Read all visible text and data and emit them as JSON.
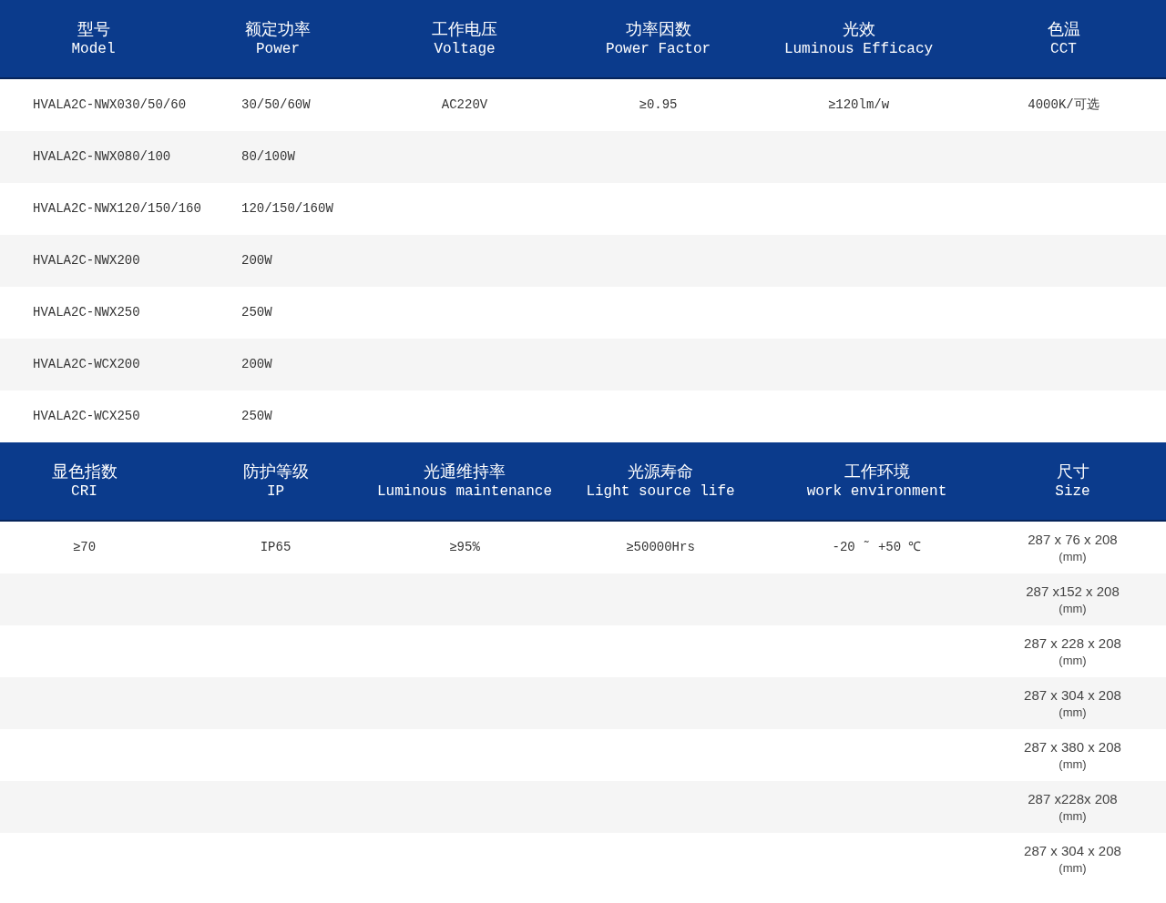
{
  "tables": [
    {
      "columns": [
        {
          "zh": "型号",
          "en": "Model"
        },
        {
          "zh": "额定功率",
          "en": "Power"
        },
        {
          "zh": "工作电压",
          "en": "Voltage"
        },
        {
          "zh": "功率因数",
          "en": "Power Factor"
        },
        {
          "zh": "光效",
          "en": "Luminous Efficacy"
        },
        {
          "zh": "色温",
          "en": "CCT"
        }
      ],
      "rows": [
        [
          "HVALA2C-NWX030/50/60",
          "30/50/60W",
          "AC220V",
          "≥0.95",
          "≥120lm/w",
          "4000K/可选"
        ],
        [
          "HVALA2C-NWX080/100",
          "80/100W",
          null,
          null,
          null,
          null
        ],
        [
          "HVALA2C-NWX120/150/160",
          "120/150/160W",
          null,
          null,
          null,
          null
        ],
        [
          "HVALA2C-NWX200",
          "200W",
          null,
          null,
          null,
          null
        ],
        [
          "HVALA2C-NWX250",
          "250W",
          null,
          null,
          null,
          null
        ],
        [
          "HVALA2C-WCX200",
          "200W",
          null,
          null,
          null,
          null
        ],
        [
          "HVALA2C-WCX250",
          "250W",
          null,
          null,
          null,
          null
        ]
      ]
    },
    {
      "columns": [
        {
          "zh": "显色指数",
          "en": "CRI"
        },
        {
          "zh": "防护等级",
          "en": "IP"
        },
        {
          "zh": "光通维持率",
          "en": "Luminous maintenance"
        },
        {
          "zh": "光源寿命",
          "en": "Light source life"
        },
        {
          "zh": "工作环境",
          "en": "work environment"
        },
        {
          "zh": "尺寸",
          "en": "Size"
        }
      ],
      "rows": [
        [
          "≥70",
          "IP65",
          "≥95%",
          "≥50000Hrs",
          "-20 ˜ +50 ℃",
          [
            "287 x 76 x 208",
            "(mm)"
          ]
        ],
        [
          null,
          null,
          null,
          null,
          null,
          [
            "287 x152 x 208",
            "(mm)"
          ]
        ],
        [
          null,
          null,
          null,
          null,
          null,
          [
            "287 x 228 x 208",
            "(mm)"
          ]
        ],
        [
          null,
          null,
          null,
          null,
          null,
          [
            "287 x 304 x 208",
            "(mm)"
          ]
        ],
        [
          null,
          null,
          null,
          null,
          null,
          [
            "287 x 380 x 208",
            "(mm)"
          ]
        ],
        [
          null,
          null,
          null,
          null,
          null,
          [
            "287 x228x 208",
            "(mm)"
          ]
        ],
        [
          null,
          null,
          null,
          null,
          null,
          [
            "287 x 304 x 208",
            "(mm)"
          ]
        ]
      ]
    }
  ]
}
